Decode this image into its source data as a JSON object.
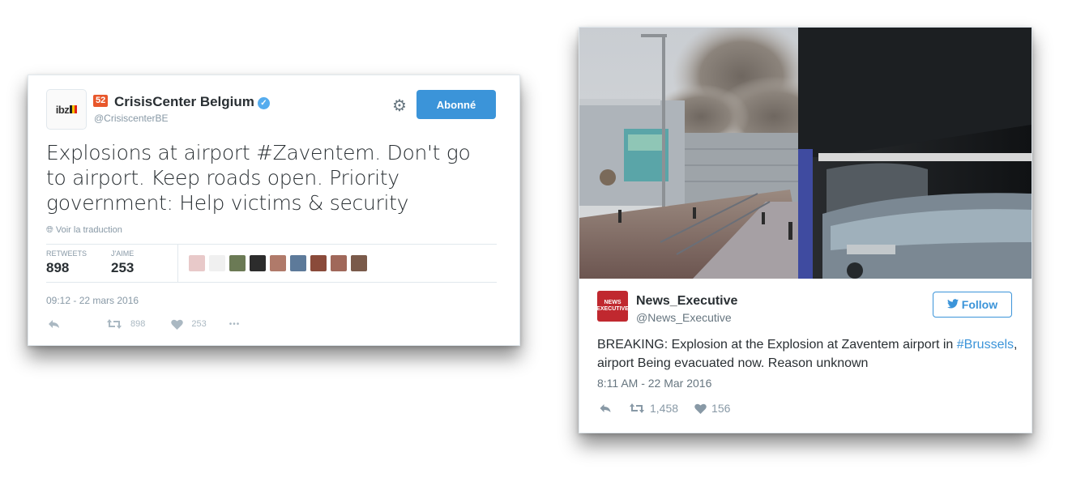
{
  "tweet1": {
    "avatar_text": "ibz",
    "badge": "52",
    "name": "CrisisCenter Belgium",
    "handle": "@CrisiscenterBE",
    "follow_label": "Abonné",
    "text": "Explosions at airport #Zaventem. Don't go to airport. Keep roads open. Priority government: Help victims & security",
    "translate_label": "Voir la traduction",
    "retweets_label": "RETWEETS",
    "retweets_value": "898",
    "likes_label": "J'AIME",
    "likes_value": "253",
    "timestamp": "09:12 - 22 mars 2016",
    "action_retweets": "898",
    "action_likes": "253",
    "more_label": "•••",
    "liker_colors": [
      "#e8c9c9",
      "#f0f0f0",
      "#6b7a55",
      "#2c2c2c",
      "#b07a6a",
      "#5d7a9a",
      "#8a4a3a",
      "#a0685a",
      "#7a5a4a"
    ]
  },
  "tweet2": {
    "avatar_text": "NEWS EXECUTIVE",
    "name": "News_Executive",
    "handle": "@News_Executive",
    "follow_label": "Follow",
    "text_before": "BREAKING: Explosion at the Explosion at Zaventem airport in ",
    "hashtag": "#Brussels",
    "text_after": ", airport Being evacuated now. Reason unknown",
    "timestamp": "8:11 AM - 22 Mar 2016",
    "retweets": "1,458",
    "likes": "156"
  },
  "colors": {
    "twitter_blue": "#3b94d9",
    "badge": "#e8572b",
    "verified": "#55acee"
  }
}
